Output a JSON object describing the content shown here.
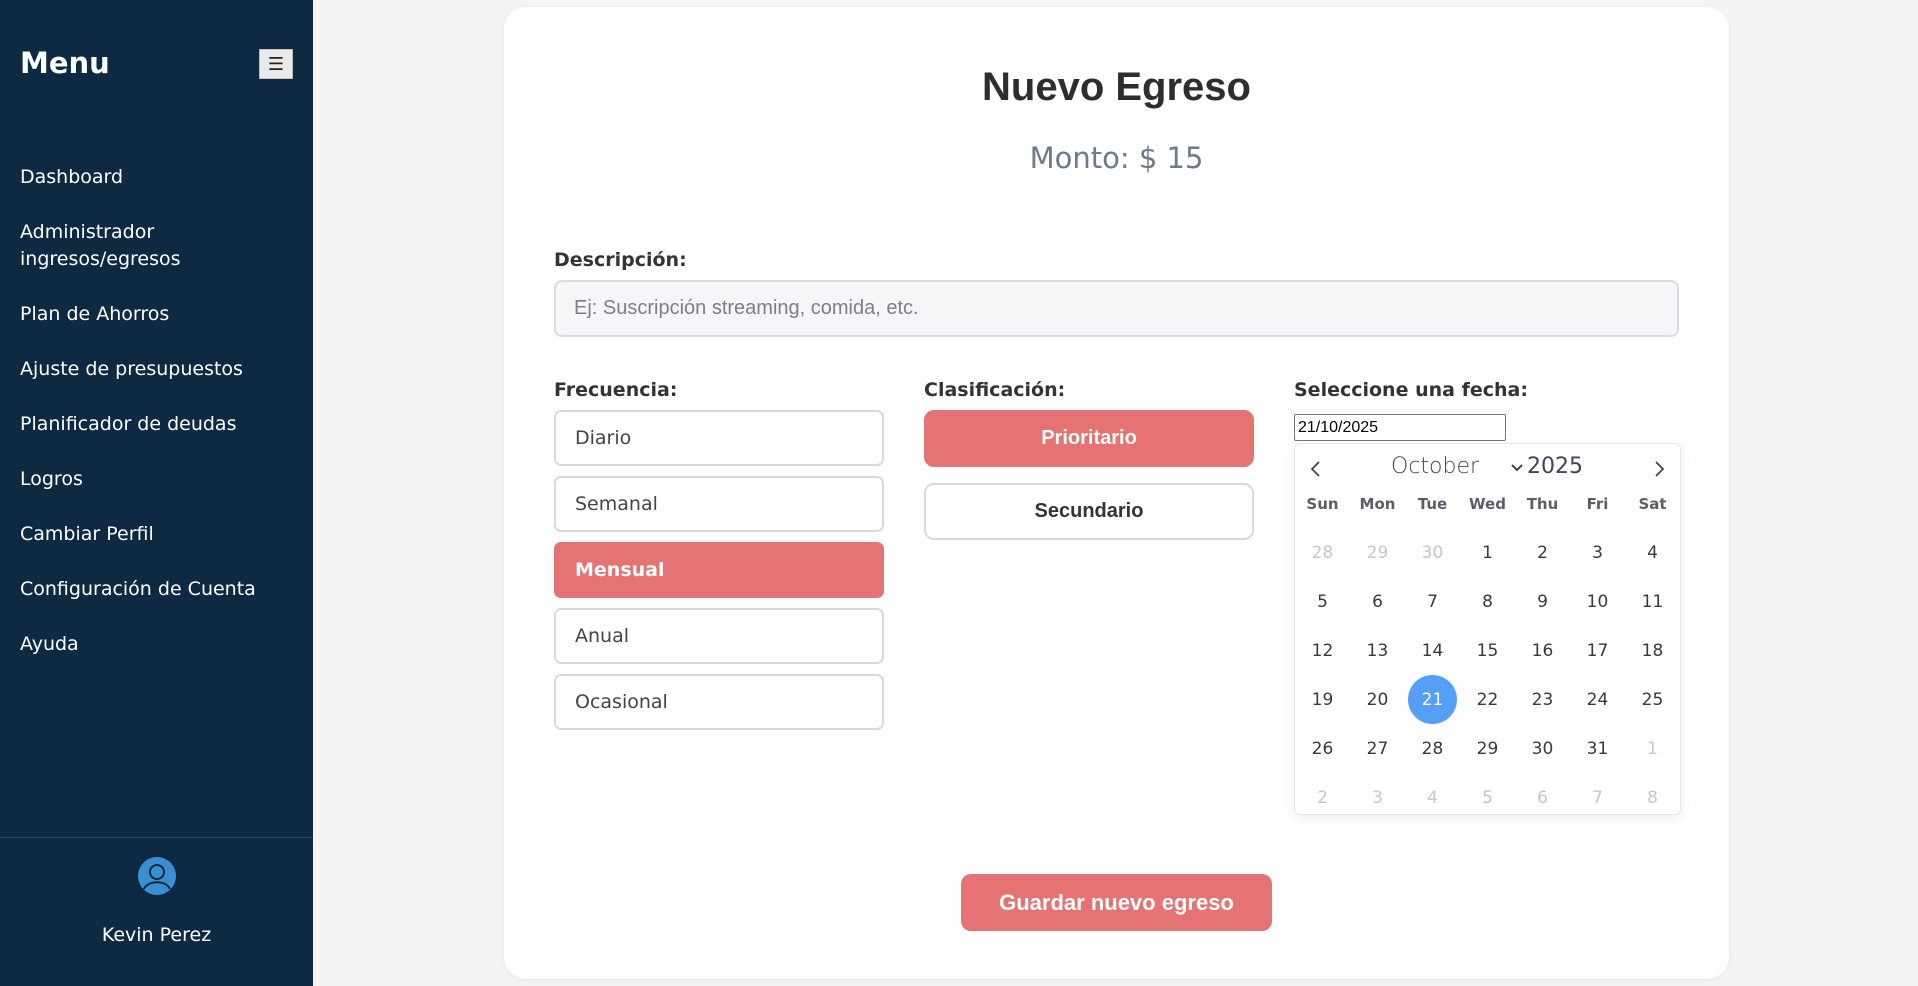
{
  "sidebar": {
    "title": "Menu",
    "toggle_label": "☰",
    "items": [
      {
        "label": "Dashboard"
      },
      {
        "label": "Administrador ingresos/egresos"
      },
      {
        "label": "Plan de Ahorros"
      },
      {
        "label": "Ajuste de presupuestos"
      },
      {
        "label": "Planificador de deudas"
      },
      {
        "label": "Logros"
      },
      {
        "label": "Cambiar Perfil"
      },
      {
        "label": "Configuración de Cuenta"
      },
      {
        "label": "Ayuda"
      }
    ],
    "user": {
      "name": "Kevin Perez",
      "avatar_icon": "user-avatar-icon"
    }
  },
  "form": {
    "title": "Nuevo Egreso",
    "amount_text": "Monto: $ 15",
    "description": {
      "label": "Descripción:",
      "value": "",
      "placeholder": "Ej: Suscripción streaming, comida, etc."
    },
    "frequency": {
      "label": "Frecuencia:",
      "options": [
        "Diario",
        "Semanal",
        "Mensual",
        "Anual",
        "Ocasional"
      ],
      "selected": "Mensual"
    },
    "classification": {
      "label": "Clasificación:",
      "options": [
        "Prioritario",
        "Secundario"
      ],
      "selected": "Prioritario"
    },
    "date": {
      "label": "Seleccione una fecha:",
      "value": "21/10/2025"
    },
    "save_label": "Guardar nuevo egreso"
  },
  "calendar": {
    "month": "October",
    "year": "2025",
    "weekdays": [
      "Sun",
      "Mon",
      "Tue",
      "Wed",
      "Thu",
      "Fri",
      "Sat"
    ],
    "weeks": [
      [
        "28",
        "29",
        "30",
        "1",
        "2",
        "3",
        "4"
      ],
      [
        "5",
        "6",
        "7",
        "8",
        "9",
        "10",
        "11"
      ],
      [
        "12",
        "13",
        "14",
        "15",
        "16",
        "17",
        "18"
      ],
      [
        "19",
        "20",
        "21",
        "22",
        "23",
        "24",
        "25"
      ],
      [
        "26",
        "27",
        "28",
        "29",
        "30",
        "31",
        "1"
      ],
      [
        "2",
        "3",
        "4",
        "5",
        "6",
        "7",
        "8"
      ]
    ],
    "selected_day": "21"
  },
  "colors": {
    "sidebar_bg": "#0d2a42",
    "accent": "#e57373",
    "selected_day": "#569ff7",
    "page_bg": "#f4f4f6"
  }
}
